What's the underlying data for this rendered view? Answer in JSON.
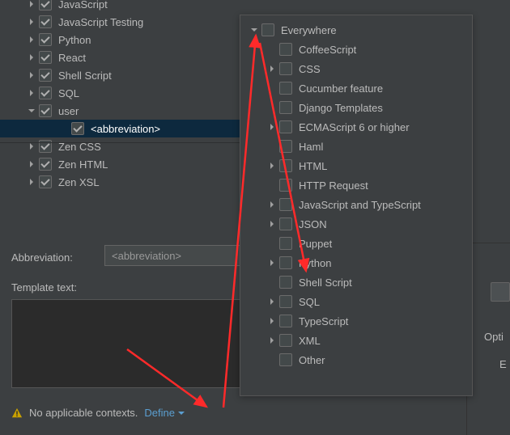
{
  "tree": [
    {
      "label": "JavaScript",
      "chev": "right",
      "checked": true,
      "indent": 1
    },
    {
      "label": "JavaScript Testing",
      "chev": "right",
      "checked": true,
      "indent": 1
    },
    {
      "label": "Python",
      "chev": "right",
      "checked": true,
      "indent": 1
    },
    {
      "label": "React",
      "chev": "right",
      "checked": true,
      "indent": 1
    },
    {
      "label": "Shell Script",
      "chev": "right",
      "checked": true,
      "indent": 1
    },
    {
      "label": "SQL",
      "chev": "right",
      "checked": true,
      "indent": 1
    },
    {
      "label": "user",
      "chev": "down",
      "checked": true,
      "indent": 1
    },
    {
      "label": "<abbreviation>",
      "chev": "none",
      "checked": true,
      "indent": 2,
      "selected": true
    },
    {
      "label": "Zen CSS",
      "chev": "right",
      "checked": true,
      "indent": 1
    },
    {
      "label": "Zen HTML",
      "chev": "right",
      "checked": true,
      "indent": 1
    },
    {
      "label": "Zen XSL",
      "chev": "right",
      "checked": true,
      "indent": 1
    }
  ],
  "abbr": {
    "label": "Abbreviation:",
    "value": "<abbreviation>"
  },
  "templateLabel": "Template text:",
  "warn": {
    "text": "No applicable contexts.",
    "define": "Define"
  },
  "popup": [
    {
      "label": "Everywhere",
      "chev": "down",
      "indent": 0
    },
    {
      "label": "CoffeeScript",
      "chev": "none",
      "indent": 1
    },
    {
      "label": "CSS",
      "chev": "right",
      "indent": 1
    },
    {
      "label": "Cucumber feature",
      "chev": "none",
      "indent": 1
    },
    {
      "label": "Django Templates",
      "chev": "none",
      "indent": 1
    },
    {
      "label": "ECMAScript 6 or higher",
      "chev": "right",
      "indent": 1
    },
    {
      "label": "Haml",
      "chev": "none",
      "indent": 1
    },
    {
      "label": "HTML",
      "chev": "right",
      "indent": 1
    },
    {
      "label": "HTTP Request",
      "chev": "none",
      "indent": 1
    },
    {
      "label": "JavaScript and TypeScript",
      "chev": "right",
      "indent": 1
    },
    {
      "label": "JSON",
      "chev": "right",
      "indent": 1
    },
    {
      "label": "Puppet",
      "chev": "none",
      "indent": 1
    },
    {
      "label": "Python",
      "chev": "right",
      "indent": 1
    },
    {
      "label": "Shell Script",
      "chev": "none",
      "indent": 1
    },
    {
      "label": "SQL",
      "chev": "right",
      "indent": 1
    },
    {
      "label": "TypeScript",
      "chev": "right",
      "indent": 1
    },
    {
      "label": "XML",
      "chev": "right",
      "indent": 1
    },
    {
      "label": "Other",
      "chev": "none",
      "indent": 1
    }
  ],
  "side": {
    "options": "Opti",
    "e": "E"
  }
}
